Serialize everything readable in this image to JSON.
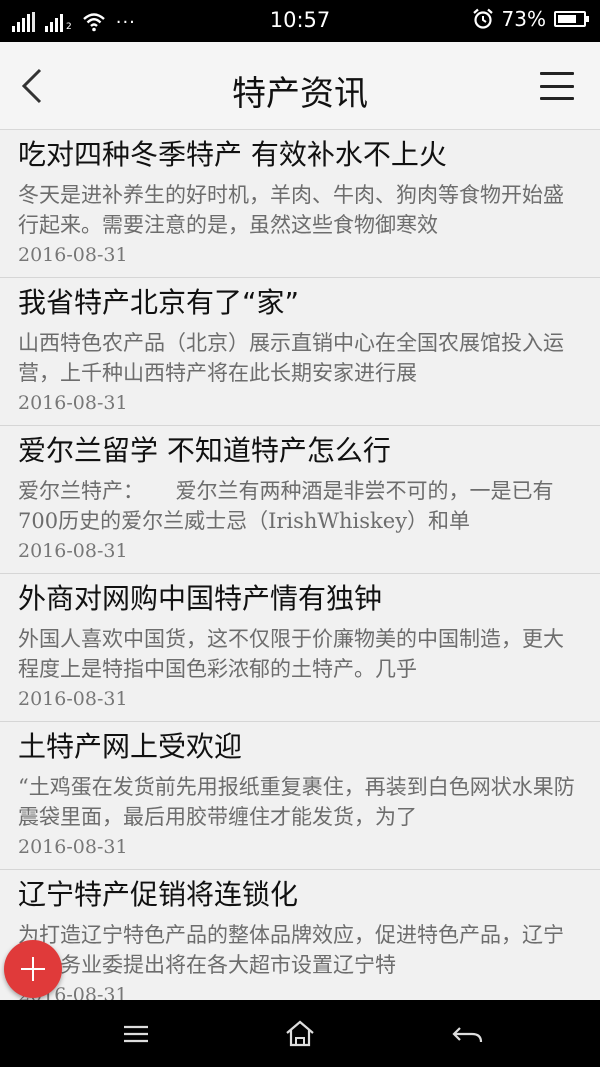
{
  "status_bar": {
    "time": "10:57",
    "battery": "73%",
    "battery_level": 0.73,
    "icons": [
      "signal-icon",
      "signal-icon",
      "wifi-icon",
      "more-dots-icon",
      "alarm-icon",
      "battery-icon"
    ],
    "sim2_label": "2",
    "dots": "···"
  },
  "header": {
    "title": "特产资讯",
    "back_icon": "chevron-left-icon",
    "menu_icon": "hamburger-menu-icon"
  },
  "articles": [
    {
      "title": "吃对四种冬季特产 有效补水不上火",
      "summary": "冬天是进补养生的好时机，羊肉、牛肉、狗肉等食物开始盛行起来。需要注意的是，虽然这些食物御寒效",
      "date": "2016-08-31"
    },
    {
      "title": "我省特产北京有了“家”",
      "summary": "山西特色农产品（北京）展示直销中心在全国农展馆投入运营，上千种山西特产将在此长期安家进行展",
      "date": "2016-08-31"
    },
    {
      "title": "爱尔兰留学 不知道特产怎么行",
      "summary": "爱尔兰特产：　　爱尔兰有两种酒是非尝不可的，一是已有700历史的爱尔兰威士忌（IrishWhiskey）和单",
      "date": "2016-08-31"
    },
    {
      "title": "外商对网购中国特产情有独钟",
      "summary": "外国人喜欢中国货，这不仅限于价廉物美的中国制造，更大程度上是特指中国色彩浓郁的土特产。几乎",
      "date": "2016-08-31"
    },
    {
      "title": "土特产网上受欢迎",
      "summary": "“土鸡蛋在发货前先用报纸重复裹住，再装到白色网状水果防震袋里面，最后用胶带缠住才能发货，为了",
      "date": "2016-08-31"
    },
    {
      "title": "辽宁特产促销将连锁化",
      "summary": "为打造辽宁特色产品的整体品牌效应，促进特色产品，辽宁省服务业委提出将在各大超市设置辽宁特",
      "date": "2016-08-31"
    }
  ],
  "fab": {
    "icon": "plus-icon",
    "color": "#e03a3a"
  },
  "nav_bar": {
    "icons": [
      "recent-apps-icon",
      "home-icon",
      "back-arrow-icon"
    ]
  },
  "colors": {
    "accent": "#e03a3a",
    "title_text": "#111111",
    "summary_text": "#6d6d6d",
    "background": "#f1f1f1"
  }
}
